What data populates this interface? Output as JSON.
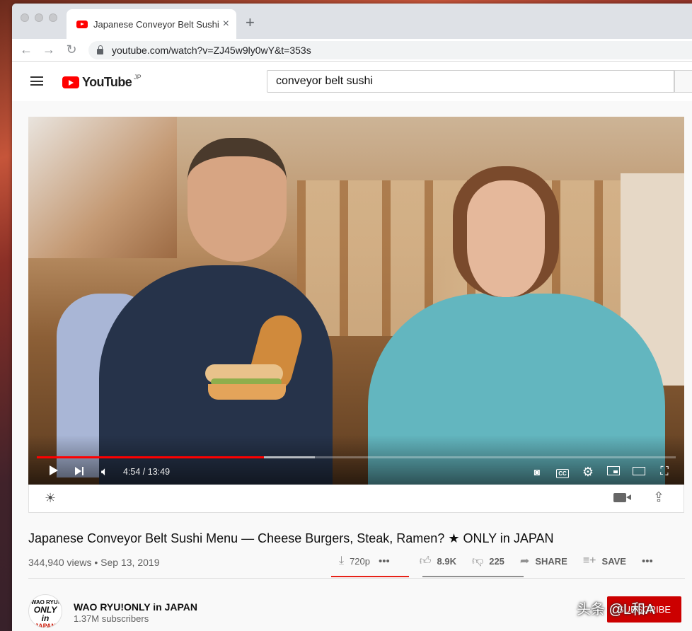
{
  "browser": {
    "tab_title": "Japanese Conveyor Belt Sushi",
    "url": "youtube.com/watch?v=ZJ45w9ly0wY&t=353s"
  },
  "youtube": {
    "logo_text": "YouTube",
    "region": "JP",
    "search_value": "conveyor belt sushi"
  },
  "player": {
    "time_display": "4:54 / 13:49",
    "played_fraction": 0.355,
    "buffered_fraction": 0.435
  },
  "video": {
    "title": "Japanese Conveyor Belt Sushi Menu — Cheese Burgers, Steak, Ramen? ★ ONLY in JAPAN",
    "meta": "344,940 views • Sep 13, 2019",
    "download_quality": "720p",
    "likes": "8.9K",
    "dislikes": "225",
    "share_label": "SHARE",
    "save_label": "SAVE"
  },
  "channel": {
    "name": "WAO RYU!ONLY in JAPAN",
    "subscribers": "1.37M subscribers",
    "avatar_line1": "WAO RYU!",
    "avatar_line2": "ONLY in",
    "avatar_line3": "JAPAN",
    "subscribe_label": "SUBSCRIBE"
  },
  "overlay": {
    "watermark": "头条 @L和A"
  },
  "colors": {
    "accent": "#ff0000",
    "subscribe": "#cc0000"
  }
}
